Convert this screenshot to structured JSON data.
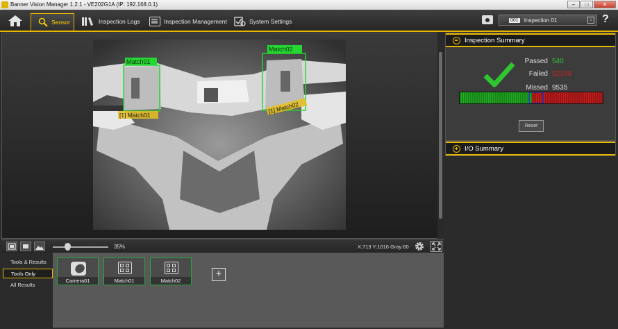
{
  "window": {
    "title": "Banner Vision Manager 1.2.1 - VE202G1A (IP: 192.168.0.1)",
    "min": "–",
    "max": "□",
    "close": "✕"
  },
  "toolbar": {
    "home_icon": "home-icon",
    "tabs": [
      {
        "label": "Sensor",
        "icon": "magnifier-gear-icon",
        "active": true
      },
      {
        "label": "Inspection Logs",
        "icon": "books-icon"
      },
      {
        "label": "Inspection Management",
        "icon": "list-icon"
      },
      {
        "label": "System Settings",
        "icon": "settings-check-icon"
      }
    ],
    "inspection_number": "001",
    "inspection_name": "Inspection 01",
    "inspection_dropdown": "↓",
    "help": "?",
    "accent": "#e8b800"
  },
  "viewer": {
    "overlays": [
      {
        "label": "Match01",
        "tag": "[1] Match01"
      },
      {
        "label": "Match02",
        "tag": "[1] Match02"
      }
    ],
    "zoom": "35%",
    "zoom_level": 0.35,
    "coords": "X:713 Y:1016 Gray:60"
  },
  "tools_panel": {
    "filters": [
      "Tools & Results",
      "Tools Only",
      "All Results"
    ],
    "active_filter": "Tools Only",
    "tools": [
      {
        "label": "Camera01",
        "icon": "camera-icon"
      },
      {
        "label": "Match01",
        "icon": "match-grid-icon"
      },
      {
        "label": "Match02",
        "icon": "match-grid-icon"
      }
    ],
    "add": "+",
    "pass_color": "#23a83a"
  },
  "summary": {
    "title": "Inspection Summary",
    "passed_label": "Passed",
    "passed": "540",
    "failed_label": "Failed",
    "failed": "52169",
    "missed_label": "Missed",
    "missed": "9535",
    "passed_color": "#2fc62f",
    "failed_color": "#d42020",
    "reset": "Reset"
  },
  "io": {
    "title": "I/O Summary"
  }
}
